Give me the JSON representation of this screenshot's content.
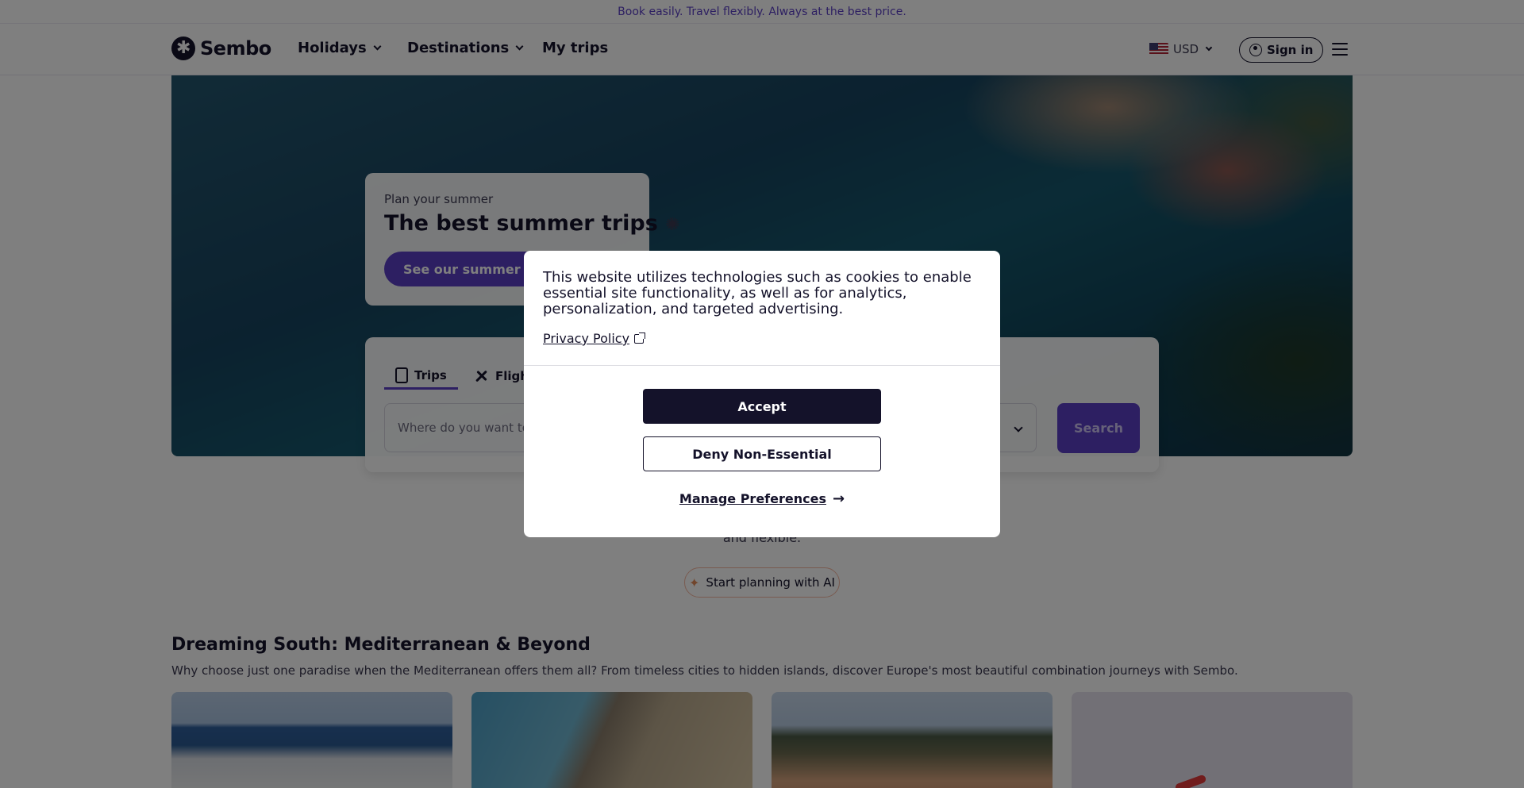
{
  "announcement": "Book easily. Travel flexibly. Always at the best price.",
  "nav": {
    "logo": "Sembo",
    "links": [
      {
        "label": "Holidays"
      },
      {
        "label": "Destinations"
      },
      {
        "label": "My trips"
      }
    ],
    "currency": "USD",
    "signin": "Sign in"
  },
  "promo": {
    "kicker": "Plan your summer",
    "title": "The best summer trips",
    "title_icon": "✺",
    "button": "See our summer deals"
  },
  "search": {
    "tabs": [
      {
        "label": "Trips",
        "icon": "bag-icon"
      },
      {
        "label": "Flights",
        "icon": "plane-icon"
      }
    ],
    "where_placeholder": "Where do you want to travel?",
    "search_button": "Search"
  },
  "intro_tail": "and flexible.",
  "ai_button": "Start planning with AI",
  "section": {
    "title": "Dreaming South: Mediterranean & Beyond",
    "description": "Why choose just one paradise when the Mediterranean offers them all? From timeless cities to hidden islands, discover Europe's most beautiful combination journeys with Sembo."
  },
  "cookie_modal": {
    "message": "This website utilizes technologies such as cookies to enable essential site functionality, as well as for analytics, personalization, and targeted advertising.",
    "privacy_link": "Privacy Policy",
    "accept": "Accept",
    "deny": "Deny Non-Essential",
    "manage": "Manage Preferences"
  },
  "colors": {
    "brand_purple": "#5b3fc4",
    "dark": "#14122a",
    "overlay": "rgba(0,0,0,0.5)"
  }
}
